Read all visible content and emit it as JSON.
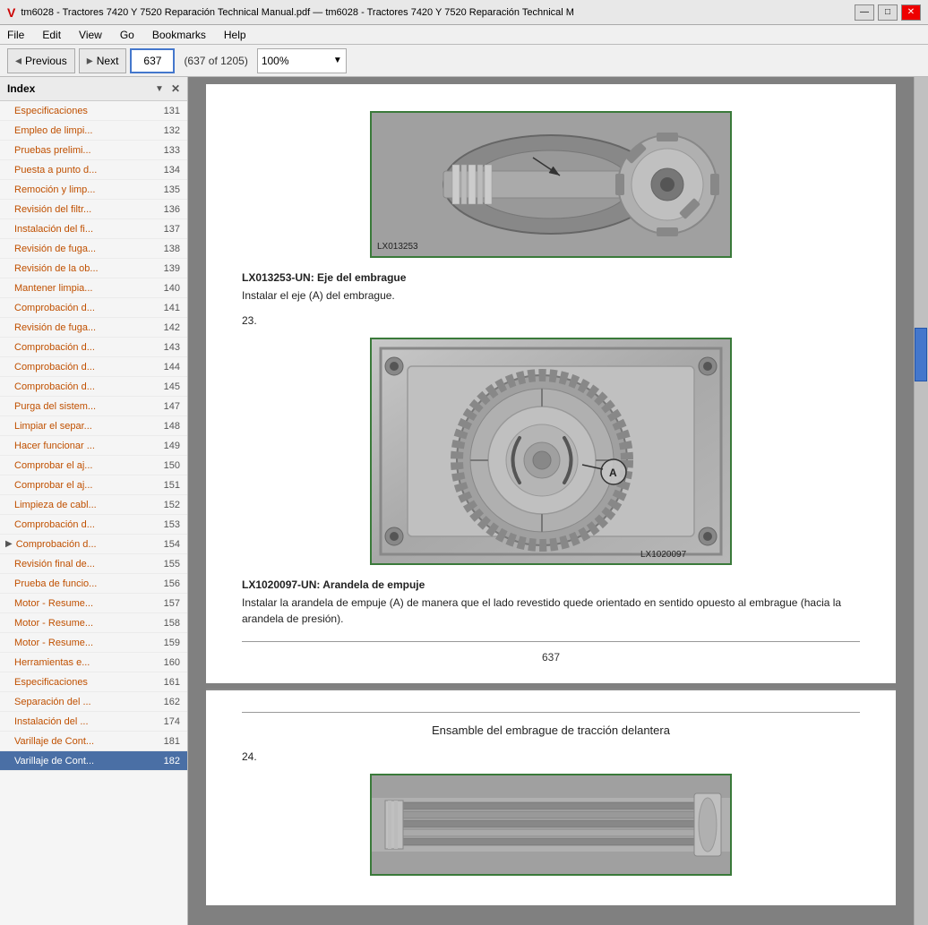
{
  "titlebar": {
    "icon": "V",
    "title": "tm6028 - Tractores 7420 Y 7520 Reparación Technical Manual.pdf — tm6028 - Tractores 7420 Y 7520 Reparación Technical M",
    "minimize": "—",
    "maximize": "□",
    "close": "✕"
  },
  "menubar": {
    "items": [
      "File",
      "Edit",
      "View",
      "Go",
      "Bookmarks",
      "Help"
    ]
  },
  "toolbar": {
    "previous_label": "Previous",
    "next_label": "Next",
    "page_current": "637",
    "page_info": "(637 of 1205)",
    "zoom_value": "100%"
  },
  "sidebar": {
    "title": "Index",
    "close_symbol": "✕",
    "items": [
      {
        "title": "Especificaciones",
        "num": "131",
        "active": false
      },
      {
        "title": "Empleo de limpi...",
        "num": "132",
        "active": false
      },
      {
        "title": "Pruebas prelimi...",
        "num": "133",
        "active": false
      },
      {
        "title": "Puesta a punto d...",
        "num": "134",
        "active": false
      },
      {
        "title": "Remoción y limp...",
        "num": "135",
        "active": false
      },
      {
        "title": "Revisión del filtr...",
        "num": "136",
        "active": false
      },
      {
        "title": "Instalación del fi...",
        "num": "137",
        "active": false
      },
      {
        "title": "Revisión de fuga...",
        "num": "138",
        "active": false
      },
      {
        "title": "Revisión de la ob...",
        "num": "139",
        "active": false
      },
      {
        "title": "Mantener limpia...",
        "num": "140",
        "active": false
      },
      {
        "title": "Comprobación d...",
        "num": "141",
        "active": false
      },
      {
        "title": "Revisión de fuga...",
        "num": "142",
        "active": false
      },
      {
        "title": "Comprobación d...",
        "num": "143",
        "active": false
      },
      {
        "title": "Comprobación d...",
        "num": "144",
        "active": false
      },
      {
        "title": "Comprobación d...",
        "num": "145",
        "active": false
      },
      {
        "title": "Purga del sistem...",
        "num": "147",
        "active": false
      },
      {
        "title": "Limpiar el separ...",
        "num": "148",
        "active": false
      },
      {
        "title": "Hacer funcionar ...",
        "num": "149",
        "active": false
      },
      {
        "title": "Comprobar el aj...",
        "num": "150",
        "active": false
      },
      {
        "title": "Comprobar el aj...",
        "num": "151",
        "active": false
      },
      {
        "title": "Limpieza de cabl...",
        "num": "152",
        "active": false
      },
      {
        "title": "Comprobación d...",
        "num": "153",
        "active": false
      },
      {
        "title": "Comprobación d...",
        "num": "154",
        "active": false,
        "arrow": true
      },
      {
        "title": "Revisión final de...",
        "num": "155",
        "active": false
      },
      {
        "title": "Prueba de funcio...",
        "num": "156",
        "active": false
      },
      {
        "title": "Motor - Resume...",
        "num": "157",
        "active": false
      },
      {
        "title": "Motor - Resume...",
        "num": "158",
        "active": false
      },
      {
        "title": "Motor - Resume...",
        "num": "159",
        "active": false
      },
      {
        "title": "Herramientas e...",
        "num": "160",
        "active": false
      },
      {
        "title": "Especificaciones",
        "num": "161",
        "active": false
      },
      {
        "title": "Separación del ...",
        "num": "162",
        "active": false
      },
      {
        "title": "Instalación del ...",
        "num": "174",
        "active": false
      },
      {
        "title": "Varillaje de Cont...",
        "num": "181",
        "active": false
      },
      {
        "title": "Varillaje de Cont...",
        "num": "182",
        "active": true
      }
    ]
  },
  "content": {
    "page1": {
      "img1_label": "LX013253",
      "caption1_bold": "LX013253-UN: Eje del embrague",
      "caption1_text": "Instalar el eje (A) del embrague.",
      "step23": "23.",
      "img2_label": "LX1020097",
      "caption2_bold": "LX1020097-UN: Arandela de empuje",
      "caption2_text": "Instalar la arandela de empuje (A) de manera que el lado revestido quede orientado en sentido opuesto al embrague (hacia la arandela de presión).",
      "page_num": "637"
    },
    "page2": {
      "section_title": "Ensamble del embrague de tracción delantera",
      "step24": "24."
    }
  }
}
